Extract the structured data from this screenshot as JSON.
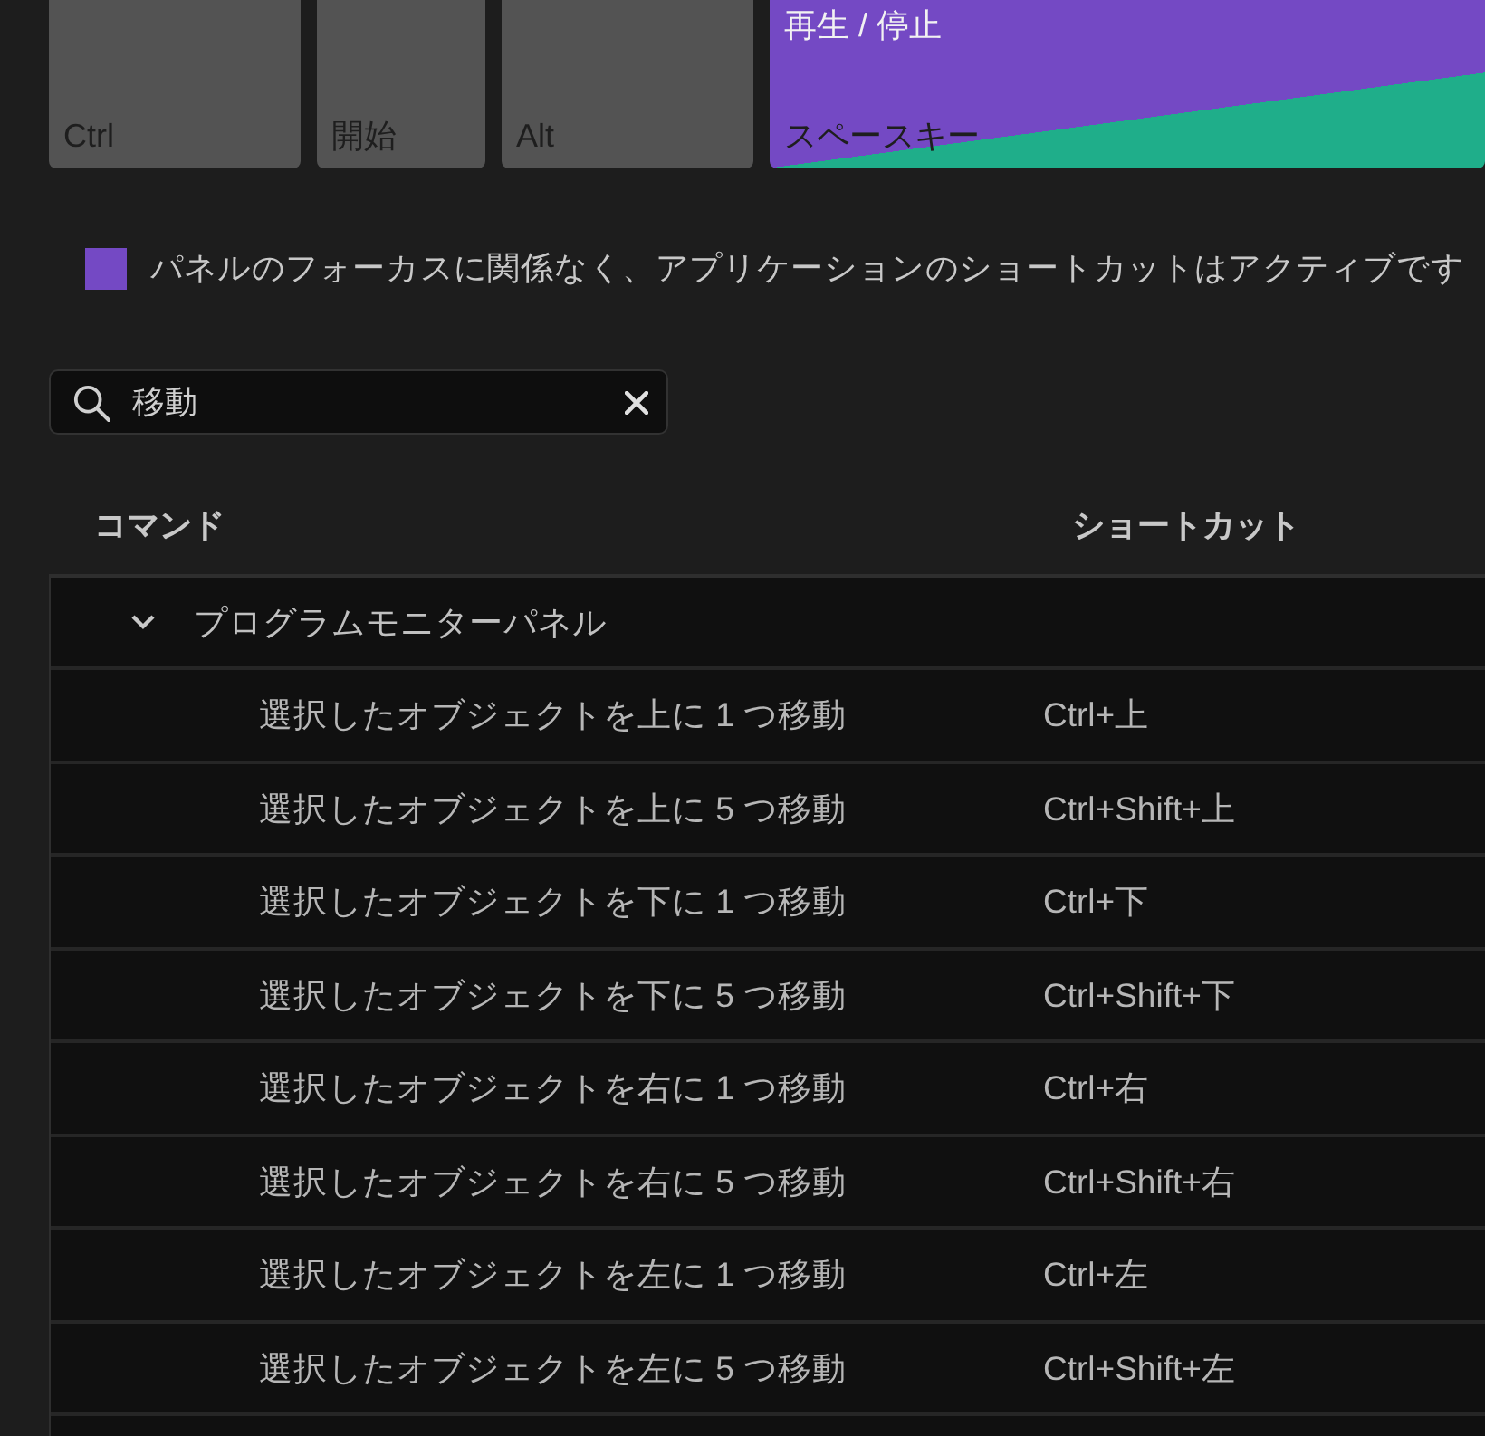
{
  "keyboard_keys": [
    {
      "kind": "plain",
      "label": "Ctrl"
    },
    {
      "kind": "plain",
      "label": "開始"
    },
    {
      "kind": "plain",
      "label": "Alt"
    },
    {
      "kind": "app_and_panel",
      "command": "再生 / 停止",
      "label": "スペースキー"
    }
  ],
  "legend": [
    {
      "color": "#7449c4",
      "label": "パネルのフォーカスに関係なく、アプリケーションのショートカットはアクティブです"
    }
  ],
  "search": {
    "value": "移動"
  },
  "table": {
    "columns": [
      "コマンド",
      "ショートカット"
    ],
    "groups": [
      {
        "name": "プログラムモニターパネル",
        "expanded": true,
        "children": [
          {
            "command": "選択したオブジェクトを上に 1 つ移動",
            "shortcut": "Ctrl+上"
          },
          {
            "command": "選択したオブジェクトを上に 5 つ移動",
            "shortcut": "Ctrl+Shift+上"
          },
          {
            "command": "選択したオブジェクトを下に 1 つ移動",
            "shortcut": "Ctrl+下"
          },
          {
            "command": "選択したオブジェクトを下に 5 つ移動",
            "shortcut": "Ctrl+Shift+下"
          },
          {
            "command": "選択したオブジェクトを右に 1 つ移動",
            "shortcut": "Ctrl+右"
          },
          {
            "command": "選択したオブジェクトを右に 5 つ移動",
            "shortcut": "Ctrl+Shift+右"
          },
          {
            "command": "選択したオブジェクトを左に 1 つ移動",
            "shortcut": "Ctrl+左"
          },
          {
            "command": "選択したオブジェクトを左に 5 つ移動",
            "shortcut": "Ctrl+Shift+左"
          }
        ]
      }
    ]
  }
}
